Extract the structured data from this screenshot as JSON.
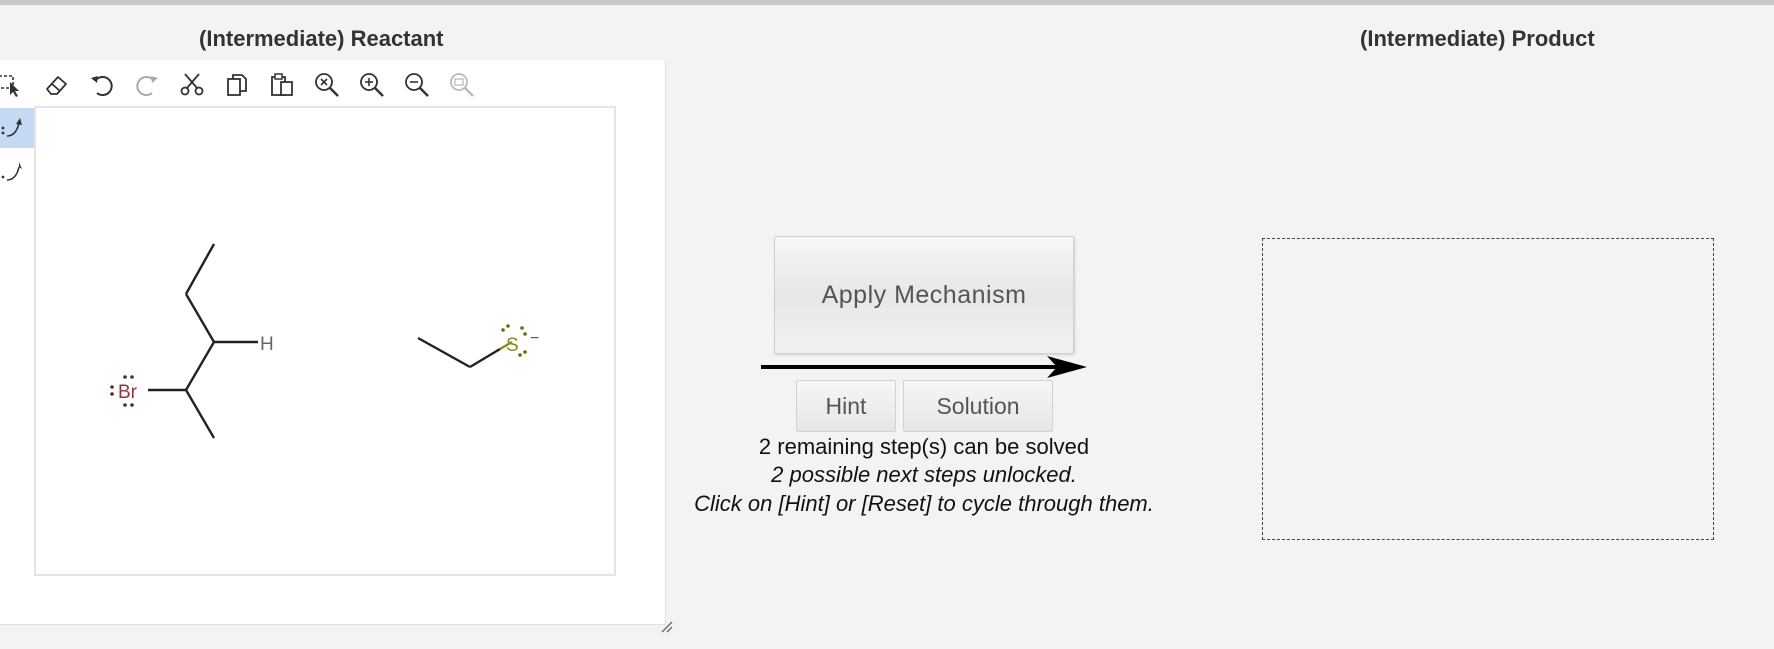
{
  "reactant_panel": {
    "title": "(Intermediate) Reactant"
  },
  "product_panel": {
    "title": "(Intermediate) Product"
  },
  "toolbar": {
    "tools": [
      {
        "name": "select-icon"
      },
      {
        "name": "eraser-icon"
      },
      {
        "name": "undo-icon"
      },
      {
        "name": "redo-icon"
      },
      {
        "name": "cut-icon"
      },
      {
        "name": "copy-icon"
      },
      {
        "name": "paste-icon"
      },
      {
        "name": "zoom-reset-icon"
      },
      {
        "name": "zoom-in-icon"
      },
      {
        "name": "zoom-out-icon"
      },
      {
        "name": "zoom-fit-icon"
      }
    ]
  },
  "molecule_labels": {
    "bromine": "Br",
    "hydrogen": "H",
    "sulfur": "S",
    "charge": "−"
  },
  "actions": {
    "apply_mechanism": "Apply Mechanism",
    "hint": "Hint",
    "solution": "Solution"
  },
  "status": {
    "line1": "2 remaining step(s) can be solved",
    "line2": "2 possible next steps unlocked.",
    "line3": "Click on [Hint] or [Reset] to cycle through them."
  },
  "colors": {
    "bromine": "#8b3a3a",
    "sulfur": "#8a8a1e",
    "selected_tool": "#c6d9f2"
  }
}
